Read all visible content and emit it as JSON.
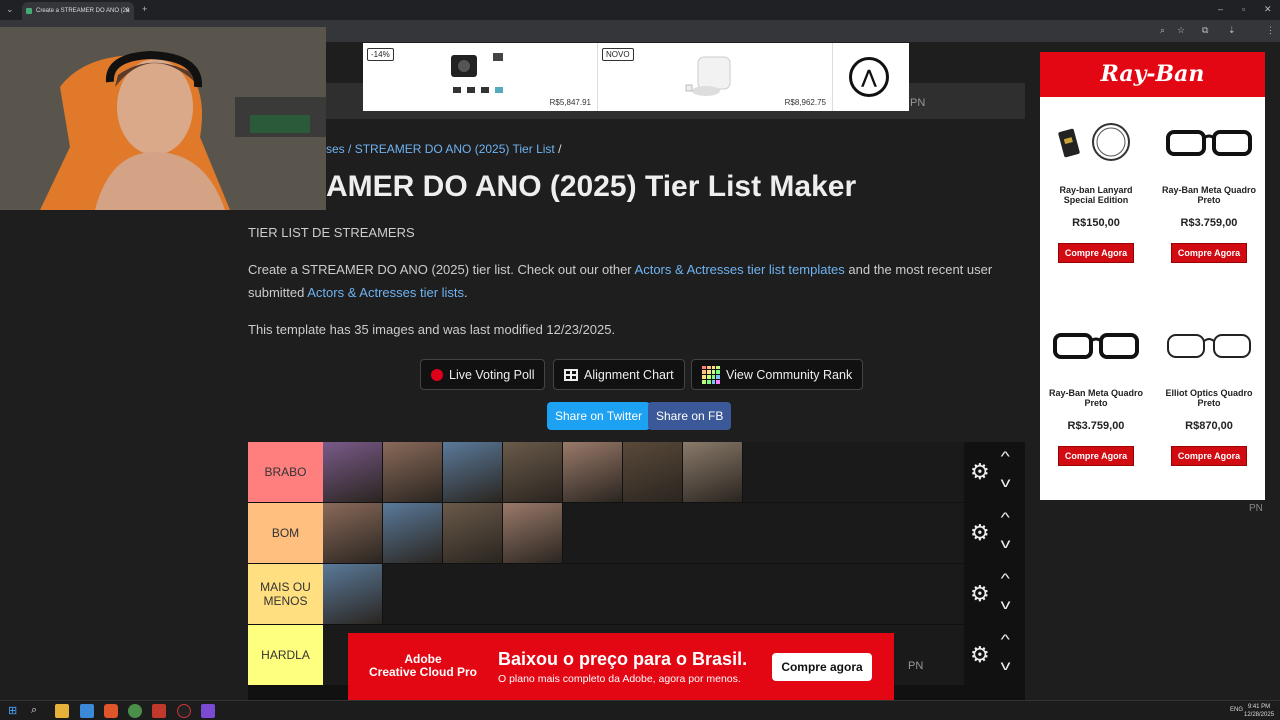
{
  "browser": {
    "tab_title": "Create a STREAMER DO ANO (20",
    "tab_close": "×",
    "new_tab": "+"
  },
  "ad_top": {
    "products": [
      {
        "badge": "-14%",
        "price": "R$5,847.91"
      },
      {
        "badge": "NOVO",
        "price": "R$8,962.75"
      }
    ],
    "nav_pn": "PN"
  },
  "breadcrumb": {
    "prefix": "ses /",
    "current": "STREAMER DO ANO (2025) Tier List",
    "sep": "/"
  },
  "page": {
    "title": "AMER DO ANO (2025) Tier List Maker",
    "subtitle": "TIER LIST DE STREAMERS",
    "desc_1": "Create a STREAMER DO ANO (2025) tier list. Check out our other ",
    "desc_link_1": "Actors & Actresses tier list templates",
    "desc_2": " and the most recent user submitted ",
    "desc_link_2": "Actors & Actresses tier lists",
    "desc_3": ".",
    "meta": "This template has 35 images and was last modified 12/23/2025."
  },
  "buttons": {
    "live_voting": "Live Voting Poll",
    "alignment": "Alignment Chart",
    "community": "View Community Rank",
    "share_twitter": "Share on Twitter",
    "share_fb": "Share on FB"
  },
  "tiers": [
    {
      "label": "BRABO",
      "color": "#ff7f7f",
      "count": 7
    },
    {
      "label": "BOM",
      "color": "#ffbf7f",
      "count": 4
    },
    {
      "label": "MAIS OU MENOS",
      "color": "#ffdf7f",
      "count": 1
    },
    {
      "label": "HARDLA",
      "color": "#ffff7f",
      "count": 0
    }
  ],
  "ad_right": {
    "brand": "Ray-Ban",
    "items": [
      {
        "name": "Ray-ban Lanyard Special Edition",
        "price": "R$150,00",
        "cta": "Compre Agora"
      },
      {
        "name": "Ray-Ban Meta Quadro Preto",
        "price": "R$3.759,00",
        "cta": "Compre Agora"
      },
      {
        "name": "Ray-Ban Meta Quadro Preto",
        "price": "R$3.759,00",
        "cta": "Compre Agora"
      },
      {
        "name": "Elliot Optics Quadro Preto",
        "price": "R$870,00",
        "cta": "Compre Agora"
      }
    ],
    "pn": "PN"
  },
  "ad_bottom": {
    "brand": "Adobe\nCreative Cloud Pro",
    "title": "Baixou o preço para o Brasil.",
    "sub": "O plano mais completo da Adobe, agora por menos.",
    "cta": "Compre agora",
    "pn": "PN"
  },
  "taskbar": {
    "lang": "ENG",
    "time": "9:41 PM",
    "date": "12/28/2025"
  },
  "colors": {
    "accent_link": "#6fb3f2",
    "twitter": "#1da1f2",
    "facebook": "#3b5998",
    "rayban_red": "#e30613"
  }
}
